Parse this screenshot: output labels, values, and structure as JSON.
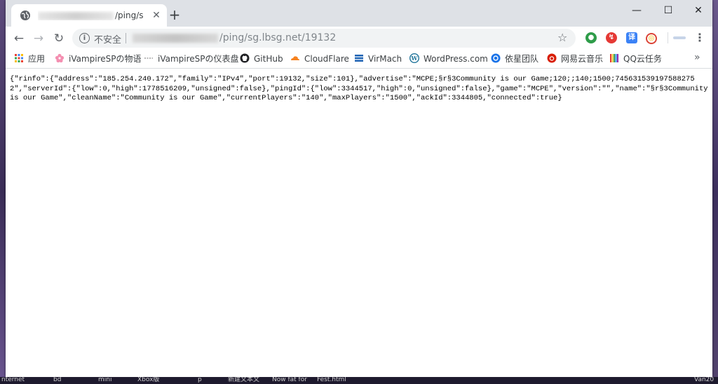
{
  "browser": {
    "tab": {
      "title_suffix": "/ping/sg.l",
      "close_label": "✕"
    },
    "new_tab_label": "+",
    "window_controls": {
      "minimize": "—",
      "maximize": "☐",
      "close": "✕"
    }
  },
  "toolbar": {
    "back": "←",
    "forward": "→",
    "reload": "↻",
    "security_label": "不安全",
    "url_visible": "/ping/sg.lbsg.net/19132",
    "star": "☆",
    "menu": "⋮",
    "extensions": [
      {
        "name": "ext-globe-icon",
        "glyph": "●",
        "color": "#2e9c49"
      },
      {
        "name": "ext-red-circle-icon",
        "glyph": "↯",
        "color": "#e53935"
      },
      {
        "name": "ext-translate-icon",
        "glyph": "译",
        "color": "#3b82f6"
      },
      {
        "name": "ext-chrome-icon",
        "glyph": "◎",
        "color": "#f4b400"
      }
    ]
  },
  "bookmarks": {
    "items": [
      {
        "label": "应用",
        "icon": "apps-grid-icon",
        "color": "#4285f4"
      },
      {
        "label": "iVampireSPの物语",
        "icon": "sakura-icon",
        "color": "#f48fb1"
      },
      {
        "label": "iVampireSPの仪表盘",
        "icon": "dash-icon",
        "color": "#9e9e9e"
      },
      {
        "label": "GitHub",
        "icon": "github-icon",
        "color": "#202124"
      },
      {
        "label": "CloudFlare",
        "icon": "cloudflare-icon",
        "color": "#f6821f"
      },
      {
        "label": "VirMach",
        "icon": "virmach-icon",
        "color": "#1e63b4"
      },
      {
        "label": "WordPress.com",
        "icon": "wordpress-icon",
        "color": "#21759b"
      },
      {
        "label": "依星团队",
        "icon": "team-icon",
        "color": "#1a73e8"
      },
      {
        "label": "网易云音乐",
        "icon": "netease-music-icon",
        "color": "#d81e06"
      },
      {
        "label": "QQ云任务",
        "icon": "qq-task-icon",
        "color": "#8e44ad"
      }
    ],
    "more": "»"
  },
  "content": {
    "json_text": "{\"rinfo\":{\"address\":\"185.254.240.172\",\"family\":\"IPv4\",\"port\":19132,\"size\":101},\"advertise\":\"MCPE;§r§3Community is our Game;120;;140;1500;7456315391975882752\",\"serverId\":{\"low\":0,\"high\":1778516209,\"unsigned\":false},\"pingId\":{\"low\":3344517,\"high\":0,\"unsigned\":false},\"game\":\"MCPE\",\"version\":\"\",\"name\":\"§r§3Community is our Game\",\"cleanName\":\"Community is our Game\",\"currentPlayers\":\"140\",\"maxPlayers\":\"1500\",\"ackId\":3344805,\"connected\":true}"
  },
  "taskbar": {
    "items": [
      "nternet",
      "bd",
      "mini",
      "Xbox版",
      "p",
      "新建文本文",
      "Now fat for",
      "Fest.html",
      "Van20"
    ]
  }
}
